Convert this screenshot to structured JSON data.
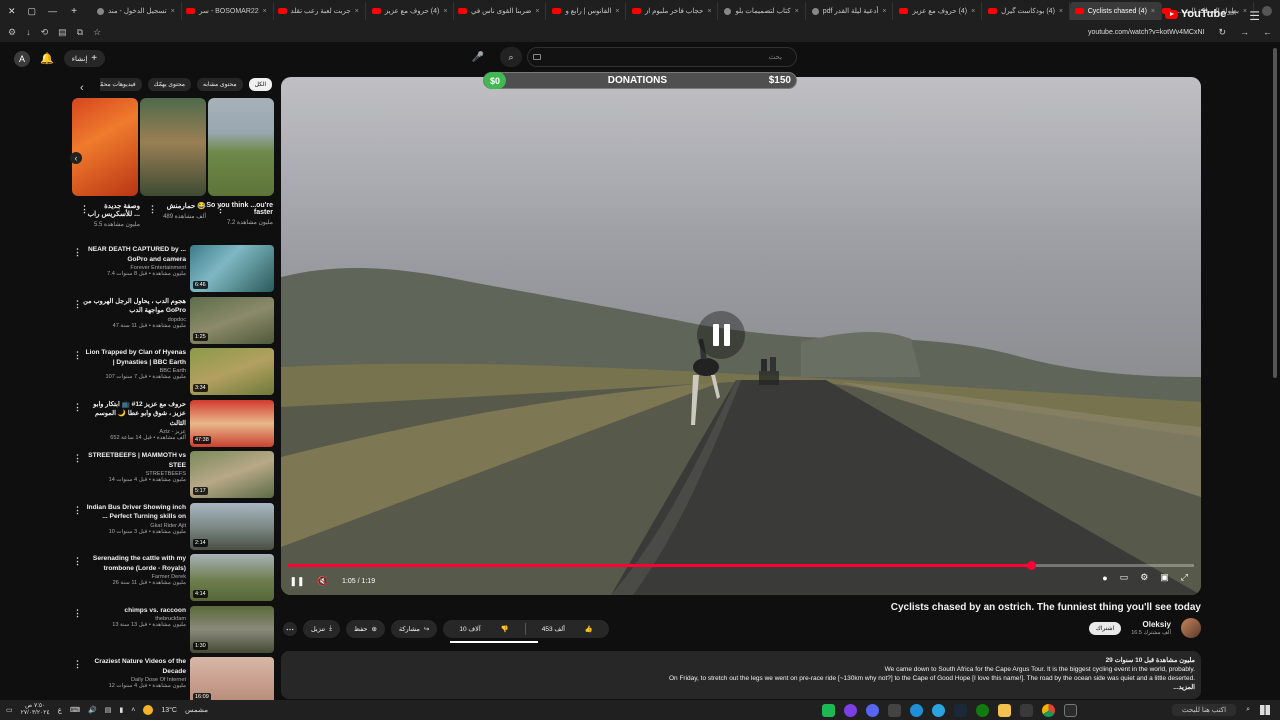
{
  "browser": {
    "tabs": [
      {
        "label": "بطولة المملكة للسه...",
        "type": "yt"
      },
      {
        "label": "(4) Cyclists chased",
        "type": "yt",
        "active": true
      },
      {
        "label": "(4) بودكاست گيرل",
        "type": "yt"
      },
      {
        "label": "(4) حروف مع عزيز",
        "type": "yt"
      },
      {
        "label": "أدعية ليلة القدر pdf",
        "type": "doc"
      },
      {
        "label": "كتاب لتصميمات بلو",
        "type": "doc"
      },
      {
        "label": "حجاب فاخر ملبوم از",
        "type": "yt"
      },
      {
        "label": "الفانوس | رابع و",
        "type": "yt"
      },
      {
        "label": "ضربنا القوى ناس في",
        "type": "yt"
      },
      {
        "label": "(4) حروف مع عزيز",
        "type": "yt"
      },
      {
        "label": "جربت لعبة رعب تقلد",
        "type": "yt"
      },
      {
        "label": "BOSOMAR22 - سر",
        "type": "yt"
      },
      {
        "label": "تسجيل الدخول - مند",
        "type": "doc"
      }
    ],
    "url": "youtube.com/watch?v=kotWv4MCxNI"
  },
  "header": {
    "create_label": "إنشاء",
    "avatar_letter": "A",
    "search_placeholder": "بحث",
    "logo_text": "YouTube",
    "logo_region": "SA"
  },
  "chips": [
    "الكل",
    "محتوى مشابه",
    "محتوى يهمّك",
    "فيديوهات محمّلة حديثًا"
  ],
  "shorts": [
    {
      "title": "So you think ...ou're faster",
      "views": "7.2 مليون مشاهدة"
    },
    {
      "title": "حمار‌منش 😂",
      "views": "489 ألف مشاهدة"
    },
    {
      "title": "وصفة جديدة للأسكريس راب ...",
      "views": "5.5 مليون مشاهدة"
    }
  ],
  "recommendations": [
    {
      "title": "NEAR DEATH CAPTURED by ... GoPro and camera",
      "channel": "Forever Entertainment",
      "meta": "7.4 مليون مشاهدة • قبل 8 سنوات",
      "duration": "6:46"
    },
    {
      "title": "هجوم الدب ، يحاول الرجل الهروب من مواجهة الدب GoPro",
      "channel": "dopdoc",
      "meta": "47 مليون مشاهدة • قبل 11 سنة",
      "duration": "1:25"
    },
    {
      "title": "Lion Trapped by Clan of Hyenas | Dynasties | BBC Earth",
      "channel": "BBC Earth",
      "meta": "107 مليون مشاهدة • قبل 7 سنوات",
      "duration": "3:34"
    },
    {
      "title": "حروف مع عزيز 12# 📺 ابتكار وابو عزيز ، شوق وابو عطا 🌙 الموسم الثالث",
      "channel": "Aziz - عزيز",
      "meta": "652 ألف مشاهدة • قبل 14 ساعة",
      "duration": "47:38"
    },
    {
      "title": "STREETBEEFS | MAMMOTH vs STEE",
      "channel": "STREETBEEFS",
      "meta": "14 مليون مشاهدة • قبل 4 سنوات",
      "duration": "5:17"
    },
    {
      "title": "Indian Bus Driver Showing inch ... Perfect Turning skills on",
      "channel": "Gkat Rider Ajit",
      "meta": "10 مليون مشاهدة • قبل 3 سنوات",
      "duration": "2:14"
    },
    {
      "title": "Serenading the cattle with my trombone (Lorde - Royals)",
      "channel": "Farmer Derek",
      "meta": "26 مليون مشاهدة • قبل 11 سنة",
      "duration": "4:14"
    },
    {
      "title": "chimps vs. raccoon",
      "channel": "thebruckfam",
      "meta": "13 مليون مشاهدة • قبل 13 سنة",
      "duration": "1:30"
    },
    {
      "title": "Craziest Nature Videos of the Decade",
      "channel": "Daily Dose Of Internet",
      "meta": "12 مليون مشاهدة • قبل 4 سنوات",
      "duration": "16:09"
    }
  ],
  "player": {
    "donation_start": "$0",
    "donation_label": "DONATIONS",
    "donation_goal": "$150",
    "time": "1:05 / 1:19",
    "progress": 0.82
  },
  "video": {
    "title": "Cyclists chased by an ostrich. The funniest thing you'll see today",
    "channel": "Oleksiy",
    "subscribers": "16.5 ألف مشترك",
    "subscribe_label": "اشتراك",
    "likes": "453 ألف",
    "dislikes": "10 آلاف",
    "share": "مشاركة",
    "save": "حفظ",
    "download": "تنزيل",
    "description_meta": "29 مليون مشاهدة قبل 10 سنوات",
    "description_line1": "We came down to South Africa for the Cape Argus Tour. It is the biggest cycling event in the world, probably.",
    "description_line2": "On Friday, to stretch out the legs we went on pre-race ride [~130km why not?] to the Cape of Good Hope [I love this name!]. The road by the ocean side was quiet and a little deserted.",
    "more": "...المزيد"
  },
  "taskbar": {
    "weather": "13°C",
    "weather_desc": "مشمس",
    "search_label": "اكتب هنا للبحث",
    "clock_time": "٧:٥٠ ص",
    "clock_date": "٢٧/٠٣/٢٠٢٤"
  }
}
